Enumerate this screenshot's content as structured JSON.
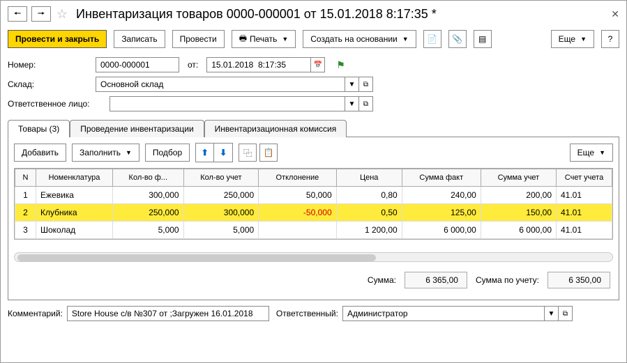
{
  "title": "Инвентаризация товаров 0000-000001 от 15.01.2018 8:17:35 *",
  "toolbar": {
    "post_close": "Провести и закрыть",
    "write": "Записать",
    "post": "Провести",
    "print": "Печать",
    "create_based": "Создать на основании",
    "more": "Еще"
  },
  "form": {
    "number_label": "Номер:",
    "number": "0000-000001",
    "from_label": "от:",
    "date": "15.01.2018  8:17:35",
    "warehouse_label": "Склад:",
    "warehouse": "Основной склад",
    "responsible_label": "Ответственное лицо:",
    "responsible": ""
  },
  "tabs": {
    "goods": "Товары (3)",
    "inventory": "Проведение инвентаризации",
    "commission": "Инвентаризационная комиссия"
  },
  "tab_toolbar": {
    "add": "Добавить",
    "fill": "Заполнить",
    "select": "Подбор",
    "more": "Еще"
  },
  "columns": {
    "n": "N",
    "nomenclature": "Номенклатура",
    "qty_fact": "Кол-во ф...",
    "qty_acc": "Кол-во учет",
    "deviation": "Отклонение",
    "price": "Цена",
    "sum_fact": "Сумма факт",
    "sum_acc": "Сумма учет",
    "account": "Счет учета"
  },
  "rows": [
    {
      "n": "1",
      "name": "Ежевика",
      "qf": "300,000",
      "qa": "250,000",
      "dev": "50,000",
      "price": "0,80",
      "sf": "240,00",
      "sa": "200,00",
      "acc": "41.01"
    },
    {
      "n": "2",
      "name": "Клубника",
      "qf": "250,000",
      "qa": "300,000",
      "dev": "-50,000",
      "price": "0,50",
      "sf": "125,00",
      "sa": "150,00",
      "acc": "41.01",
      "selected": true,
      "neg": true
    },
    {
      "n": "3",
      "name": "Шоколад",
      "qf": "5,000",
      "qa": "5,000",
      "dev": "",
      "price": "1 200,00",
      "sf": "6 000,00",
      "sa": "6 000,00",
      "acc": "41.01"
    }
  ],
  "totals": {
    "sum_label": "Сумма:",
    "sum": "6 365,00",
    "sum_acc_label": "Сумма по учету:",
    "sum_acc": "6 350,00"
  },
  "footer": {
    "comment_label": "Комментарий:",
    "comment": "Store House с/в №307 от ;Загружен 16.01.2018",
    "responsible_label": "Ответственный:",
    "responsible": "Администратор"
  }
}
